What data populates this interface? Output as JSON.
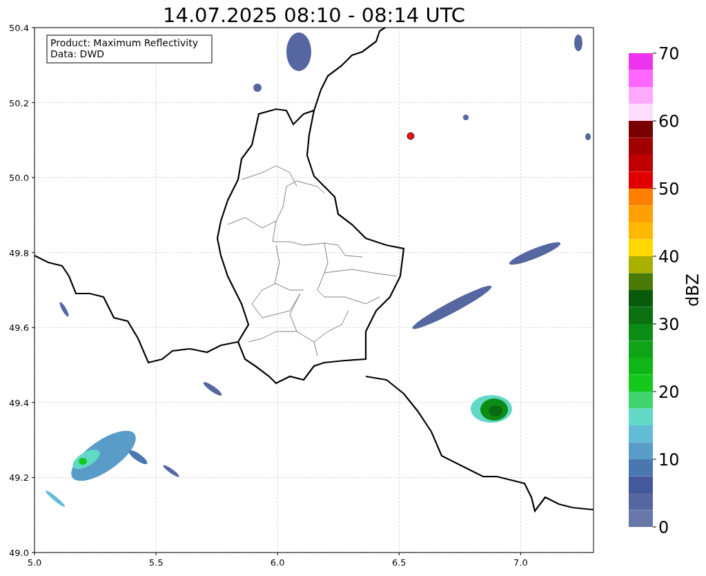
{
  "title": "14.07.2025 08:10 - 08:14 UTC",
  "legend": [
    "Product: Maximum Reflectivity",
    "Data: DWD"
  ],
  "x_ticks": [
    "5.0",
    "5.5",
    "6.0",
    "6.5",
    "7.0"
  ],
  "y_ticks": [
    "50.4",
    "50.2",
    "50.0",
    "49.8",
    "49.6",
    "49.4",
    "49.2",
    "49.0"
  ],
  "colorbar": {
    "label": "dBZ",
    "ticks": [
      "70",
      "60",
      "50",
      "40",
      "30",
      "20",
      "10",
      "0"
    ],
    "segments": [
      {
        "color": "#ee33ee"
      },
      {
        "color": "#ff66ff"
      },
      {
        "color": "#ffaaff"
      },
      {
        "color": "#ffddff"
      },
      {
        "color": "#7a0000"
      },
      {
        "color": "#a00000"
      },
      {
        "color": "#c00000"
      },
      {
        "color": "#e00000"
      },
      {
        "color": "#ff8000"
      },
      {
        "color": "#ffa000"
      },
      {
        "color": "#ffb800"
      },
      {
        "color": "#ffd800"
      },
      {
        "color": "#aab000"
      },
      {
        "color": "#4a7a08"
      },
      {
        "color": "#0a5a0c"
      },
      {
        "color": "#0a7010"
      },
      {
        "color": "#0c8c14"
      },
      {
        "color": "#0ea416"
      },
      {
        "color": "#10b618"
      },
      {
        "color": "#14c81c"
      },
      {
        "color": "#3fd46e"
      },
      {
        "color": "#62d8c6"
      },
      {
        "color": "#62bcd6"
      },
      {
        "color": "#5a9cc8"
      },
      {
        "color": "#4a77b0"
      },
      {
        "color": "#44599c"
      },
      {
        "color": "#5566a0"
      },
      {
        "color": "#6677a8"
      }
    ]
  }
}
